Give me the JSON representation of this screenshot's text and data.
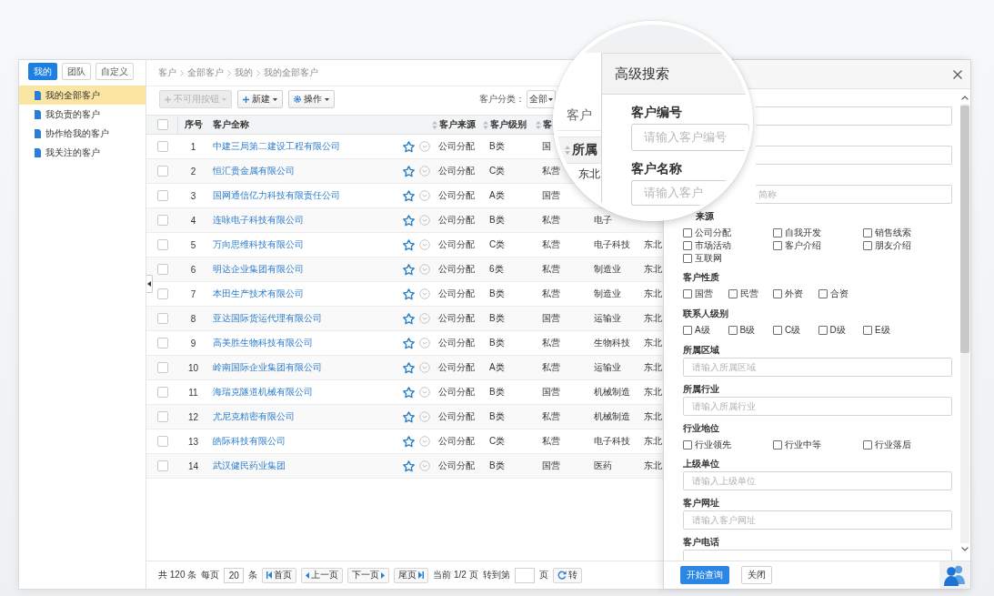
{
  "sidebar": {
    "tabs": [
      {
        "label": "我的",
        "selected": true
      },
      {
        "label": "团队",
        "selected": false
      },
      {
        "label": "自定义",
        "selected": false
      }
    ],
    "items": [
      {
        "label": "我的全部客户",
        "selected": true
      },
      {
        "label": "我负责的客户",
        "selected": false
      },
      {
        "label": "协作给我的客户",
        "selected": false
      },
      {
        "label": "我关注的客户",
        "selected": false
      }
    ]
  },
  "breadcrumb": [
    "客户",
    "全部客户",
    "我的",
    "我的全部客户"
  ],
  "toolbar": {
    "buttons": [
      {
        "label": "不可用按钮",
        "kind": "add",
        "disabled": true
      },
      {
        "label": "新建",
        "kind": "add",
        "disabled": false
      },
      {
        "label": "操作",
        "kind": "settings",
        "disabled": false
      }
    ],
    "filter": {
      "label": "客户分类：",
      "value": "全部"
    }
  },
  "table": {
    "header_checked": false,
    "columns": [
      {
        "label": "序号",
        "sortable": false
      },
      {
        "label": "客户全称",
        "sortable": false
      },
      {
        "label": "客户来源",
        "sortable": true
      },
      {
        "label": "客户级别",
        "sortable": true
      },
      {
        "label": "客",
        "sortable": true
      }
    ],
    "rows": [
      {
        "checked": false,
        "starred": false,
        "cells": [
          "1",
          "中建三局第二建设工程有限公司",
          "公司分配",
          "B类",
          "国"
        ]
      },
      {
        "checked": false,
        "starred": false,
        "cells": [
          "2",
          "恒汇贵金属有限公司",
          "公司分配",
          "C类",
          "私营"
        ]
      },
      {
        "checked": false,
        "starred": false,
        "cells": [
          "3",
          "国网通信亿力科技有限责任公司",
          "公司分配",
          "A类",
          "国营"
        ]
      },
      {
        "checked": false,
        "starred": false,
        "cells": [
          "4",
          "连咏电子科技有限公司",
          "公司分配",
          "B类",
          "私营",
          "电子"
        ]
      },
      {
        "checked": false,
        "starred": false,
        "cells": [
          "5",
          "万向思维科技有限公司",
          "公司分配",
          "C类",
          "私营",
          "电子科技",
          "东北"
        ]
      },
      {
        "checked": false,
        "starred": false,
        "cells": [
          "6",
          "明达企业集团有限公司",
          "公司分配",
          "6类",
          "私营",
          "制造业",
          "东北"
        ]
      },
      {
        "checked": false,
        "starred": false,
        "cells": [
          "7",
          "本田生产技术有限公司",
          "公司分配",
          "B类",
          "私营",
          "制造业",
          "东北"
        ]
      },
      {
        "checked": false,
        "starred": false,
        "cells": [
          "8",
          "亚达国际货运代理有限公司",
          "公司分配",
          "B类",
          "国营",
          "运输业",
          "东北"
        ]
      },
      {
        "checked": false,
        "starred": false,
        "cells": [
          "9",
          "高美胜生物科技有限公司",
          "公司分配",
          "B类",
          "私营",
          "生物科技",
          "东北"
        ]
      },
      {
        "checked": false,
        "starred": false,
        "cells": [
          "10",
          "岭南国际企业集团有限公司",
          "公司分配",
          "A类",
          "私营",
          "运输业",
          "东北"
        ]
      },
      {
        "checked": false,
        "starred": false,
        "cells": [
          "11",
          "海瑞克隧道机械有限公司",
          "公司分配",
          "B类",
          "国营",
          "机械制造",
          "东北"
        ]
      },
      {
        "checked": false,
        "starred": false,
        "cells": [
          "12",
          "尤尼克精密有限公司",
          "公司分配",
          "B类",
          "私营",
          "机械制造",
          "东北"
        ]
      },
      {
        "checked": false,
        "starred": false,
        "cells": [
          "13",
          "皓际科技有限公司",
          "公司分配",
          "C类",
          "私营",
          "电子科技",
          "东北"
        ]
      },
      {
        "checked": false,
        "starred": false,
        "cells": [
          "14",
          "武汉健民药业集团",
          "公司分配",
          "B类",
          "国营",
          "医药",
          "东北"
        ]
      }
    ]
  },
  "pagination": {
    "total": "共 120 条",
    "per_page_label": "每页",
    "per_page": "20",
    "per_page_unit": "条",
    "buttons": [
      {
        "label": "首页",
        "kind": "first"
      },
      {
        "label": "上一页",
        "kind": "prev"
      },
      {
        "label": "下一页",
        "kind": "next"
      },
      {
        "label": "尾页",
        "kind": "last"
      }
    ],
    "current": "当前 1/2 页",
    "goto_label": "转到第",
    "goto_unit": "页",
    "go": "转"
  },
  "search_panel": {
    "fields": [
      {
        "kind": "input"
      },
      {
        "kind": "input"
      },
      {
        "kind": "input",
        "placeholder": "简称"
      },
      {
        "kind": "checklist",
        "label": "来源",
        "options": [
          {
            "label": "公司分配",
            "checked": false
          },
          {
            "label": "自我开发",
            "checked": false
          },
          {
            "label": "销售线索",
            "checked": false
          },
          {
            "label": "市场活动",
            "checked": false
          },
          {
            "label": "客户介绍",
            "checked": false
          },
          {
            "label": "朋友介绍",
            "checked": false
          },
          {
            "label": "互联网",
            "checked": false
          }
        ]
      },
      {
        "kind": "checkrow",
        "label": "客户性质",
        "options": [
          {
            "label": "国营",
            "checked": false
          },
          {
            "label": "民营",
            "checked": false
          },
          {
            "label": "外资",
            "checked": false
          },
          {
            "label": "合资",
            "checked": false
          }
        ]
      },
      {
        "kind": "checkrow",
        "label": "联系人级别",
        "options": [
          {
            "label": "A级",
            "checked": false
          },
          {
            "label": "B级",
            "checked": false
          },
          {
            "label": "C级",
            "checked": false
          },
          {
            "label": "D级",
            "checked": false
          },
          {
            "label": "E级",
            "checked": false
          }
        ]
      },
      {
        "kind": "input",
        "label": "所属区域",
        "placeholder": "请输入所属区域"
      },
      {
        "kind": "input",
        "label": "所属行业",
        "placeholder": "请输入所属行业"
      },
      {
        "kind": "checklist",
        "label": "行业地位",
        "options": [
          {
            "label": "行业领先",
            "checked": false
          },
          {
            "label": "行业中等",
            "checked": false
          },
          {
            "label": "行业落后",
            "checked": false
          }
        ]
      },
      {
        "kind": "input",
        "label": "上级单位",
        "placeholder": "请输入上级单位"
      },
      {
        "kind": "input",
        "label": "客户网址",
        "placeholder": "请输入客户网址"
      },
      {
        "kind": "input",
        "label": "客户电话"
      }
    ],
    "buttons": [
      {
        "label": "开始查询",
        "kind": "primary"
      },
      {
        "label": "关闭",
        "kind": "default"
      }
    ]
  },
  "magnifier": {
    "table_label": "客户",
    "column_header": "所属",
    "column_sortable": true,
    "cell": "东北",
    "title": "高级搜索",
    "fields": [
      {
        "label": "客户编号",
        "placeholder": "请输入客户编号"
      },
      {
        "label": "客户名称",
        "placeholder": "请输入客户"
      }
    ]
  }
}
